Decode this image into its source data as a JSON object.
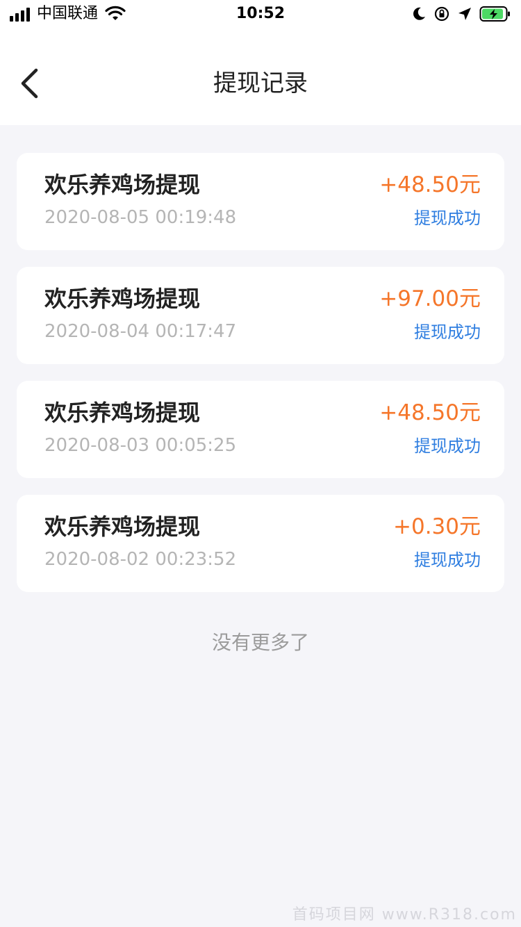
{
  "status_bar": {
    "carrier": "中国联通",
    "time": "10:52",
    "icons": [
      "signal-icon",
      "wifi-icon",
      "moon-icon",
      "orientation-lock-icon",
      "location-icon",
      "battery-charging-icon"
    ]
  },
  "nav": {
    "title": "提现记录",
    "back_icon": "chevron-left-icon"
  },
  "records": [
    {
      "title": "欢乐养鸡场提现",
      "time": "2020-08-05 00:19:48",
      "amount": "+48.50元",
      "status": "提现成功"
    },
    {
      "title": "欢乐养鸡场提现",
      "time": "2020-08-04 00:17:47",
      "amount": "+97.00元",
      "status": "提现成功"
    },
    {
      "title": "欢乐养鸡场提现",
      "time": "2020-08-03 00:05:25",
      "amount": "+48.50元",
      "status": "提现成功"
    },
    {
      "title": "欢乐养鸡场提现",
      "time": "2020-08-02 00:23:52",
      "amount": "+0.30元",
      "status": "提现成功"
    }
  ],
  "footer": {
    "no_more": "没有更多了"
  },
  "watermark": "首码项目网 www.R318.com",
  "colors": {
    "amount": "#f5762a",
    "status": "#2f7ee0",
    "background": "#f5f5f9",
    "battery": "#4cd964"
  }
}
